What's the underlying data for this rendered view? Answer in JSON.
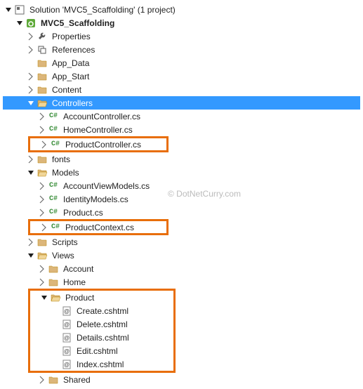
{
  "solution": {
    "label": "Solution 'MVC5_Scaffolding' (1 project)"
  },
  "project": {
    "label": "MVC5_Scaffolding"
  },
  "nodes": {
    "properties": "Properties",
    "references": "References",
    "app_data": "App_Data",
    "app_start": "App_Start",
    "content": "Content",
    "controllers": "Controllers",
    "account_controller": "AccountController.cs",
    "home_controller": "HomeController.cs",
    "product_controller": "ProductController.cs",
    "fonts": "fonts",
    "models": "Models",
    "account_view_models": "AccountViewModels.cs",
    "identity_models": "IdentityModels.cs",
    "product_cs": "Product.cs",
    "product_context": "ProductContext.cs",
    "scripts": "Scripts",
    "views": "Views",
    "account": "Account",
    "home": "Home",
    "product": "Product",
    "create_cshtml": "Create.cshtml",
    "delete_cshtml": "Delete.cshtml",
    "details_cshtml": "Details.cshtml",
    "edit_cshtml": "Edit.cshtml",
    "index_cshtml": "Index.cshtml",
    "shared": "Shared"
  },
  "watermark": "© DotNetCurry.com",
  "colors": {
    "selection": "#3399ff",
    "highlight": "#e86e0a",
    "cs_green": "#3a8e3a",
    "folder": "#dcb67a"
  }
}
